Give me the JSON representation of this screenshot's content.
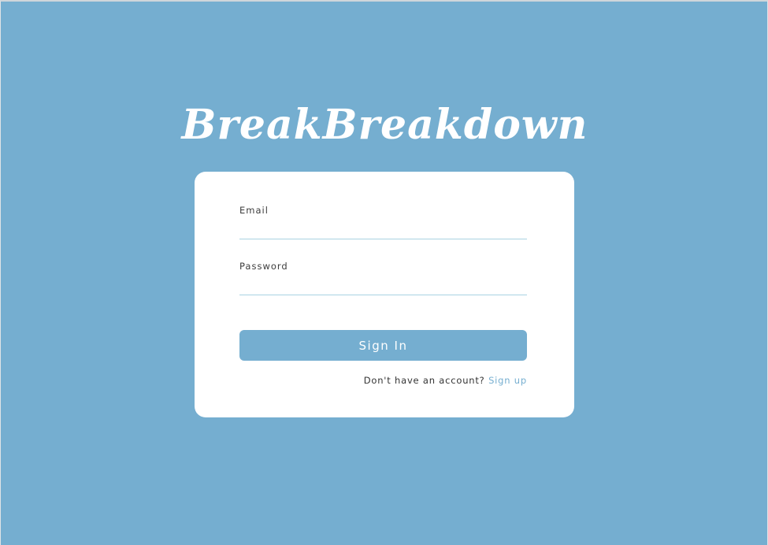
{
  "app": {
    "title": "BreakBreakdown"
  },
  "form": {
    "email_label": "Email",
    "email_value": "",
    "password_label": "Password",
    "password_value": "",
    "signin_label": "Sign In",
    "signup_prompt": "Don't have an account?",
    "signup_link": "Sign up"
  },
  "colors": {
    "background": "#75aed0",
    "card": "#ffffff",
    "accent": "#75aed0",
    "input_underline": "#a9d3e2"
  }
}
